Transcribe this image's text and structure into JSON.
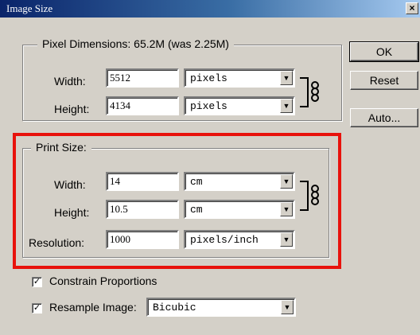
{
  "window": {
    "title": "Image Size",
    "close_glyph": "×"
  },
  "pixel_dimensions": {
    "legend": "Pixel Dimensions:  65.2M (was 2.25M)",
    "width_label": "Width:",
    "width_value": "5512",
    "width_unit": "pixels",
    "height_label": "Height:",
    "height_value": "4134",
    "height_unit": "pixels"
  },
  "print_size": {
    "legend": "Print Size:",
    "width_label": "Width:",
    "width_value": "14",
    "width_unit": "cm",
    "height_label": "Height:",
    "height_value": "10.5",
    "height_unit": "cm",
    "resolution_label": "Resolution:",
    "resolution_value": "1000",
    "resolution_unit": "pixels/inch"
  },
  "options": {
    "constrain_label": "Constrain Proportions",
    "constrain_checked": true,
    "resample_label": "Resample Image:",
    "resample_checked": true,
    "resample_method": "Bicubic",
    "check_glyph": "✓"
  },
  "buttons": {
    "ok": "OK",
    "reset": "Reset",
    "auto": "Auto..."
  },
  "icons": {
    "link": "chain-link-icon",
    "dropdown": "chevron-down-icon",
    "close": "close-icon"
  },
  "colors": {
    "dialog_bg": "#d4d0c8",
    "highlight": "#e8120c",
    "titlebar": "#0a246a"
  }
}
